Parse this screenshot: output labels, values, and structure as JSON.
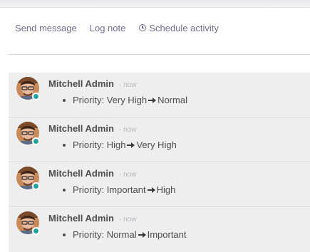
{
  "toolbar": {
    "send_message": "Send message",
    "log_note": "Log note",
    "schedule_activity": "Schedule activity"
  },
  "messages": [
    {
      "author": "Mitchell Admin",
      "date": "- now",
      "field": "Priority:",
      "old_value": "Very High",
      "new_value": "Normal"
    },
    {
      "author": "Mitchell Admin",
      "date": "- now",
      "field": "Priority:",
      "old_value": "High",
      "new_value": "Very High"
    },
    {
      "author": "Mitchell Admin",
      "date": "- now",
      "field": "Priority:",
      "old_value": "Important",
      "new_value": "High"
    },
    {
      "author": "Mitchell Admin",
      "date": "- now",
      "field": "Priority:",
      "old_value": "Normal",
      "new_value": "Important"
    }
  ],
  "colors": {
    "link": "#6f6a8e",
    "presence_online": "#20a39e",
    "thread_background": "#eeeeef"
  },
  "icons": {
    "schedule": "clock-icon",
    "change_arrow": "long-arrow-right-icon"
  }
}
